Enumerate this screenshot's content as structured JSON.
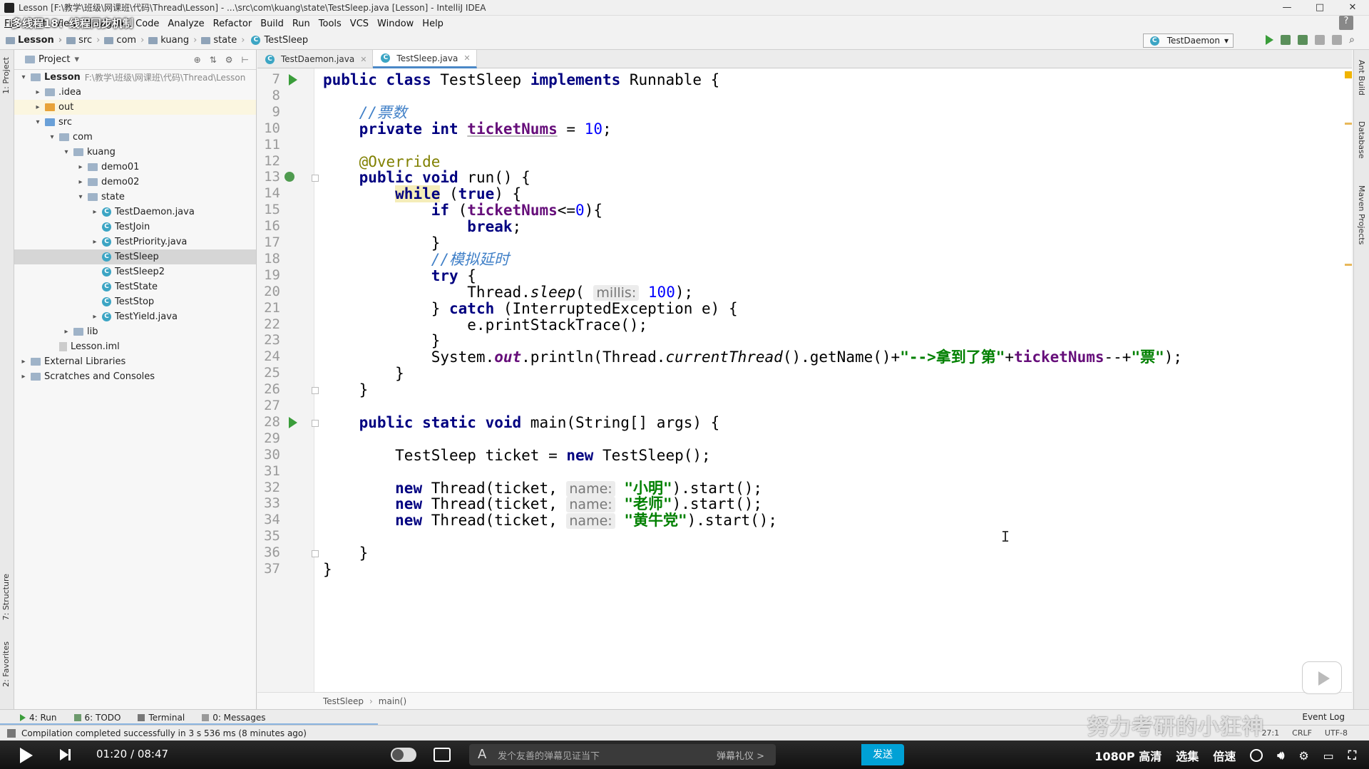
{
  "window": {
    "title": "Lesson [F:\\教学\\班级\\网课班\\代码\\Thread\\Lesson] - ...\\src\\com\\kuang\\state\\TestSleep.java [Lesson] - IntelliJ IDEA",
    "controls": [
      "—",
      "□",
      "✕"
    ]
  },
  "video_title": "多线程18：线程同步机制",
  "menu": [
    "File",
    "Edit",
    "View",
    "Navigate",
    "Code",
    "Analyze",
    "Refactor",
    "Build",
    "Run",
    "Tools",
    "VCS",
    "Window",
    "Help"
  ],
  "breadcrumb": [
    "Lesson",
    "src",
    "com",
    "kuang",
    "state",
    "TestSleep"
  ],
  "run_config": "TestDaemon",
  "project_panel": {
    "title": "Project",
    "tree": [
      {
        "label": "Lesson",
        "path": "F:\\教学\\班级\\网课班\\代码\\Thread\\Lesson",
        "depth": 0,
        "arrow": "▾",
        "icon": "folder",
        "bold": true
      },
      {
        "label": ".idea",
        "depth": 1,
        "arrow": "▸",
        "icon": "folder"
      },
      {
        "label": "out",
        "depth": 1,
        "arrow": "▸",
        "icon": "folder-orange",
        "highlight": true
      },
      {
        "label": "src",
        "depth": 1,
        "arrow": "▾",
        "icon": "folder-blue"
      },
      {
        "label": "com",
        "depth": 2,
        "arrow": "▾",
        "icon": "folder"
      },
      {
        "label": "kuang",
        "depth": 3,
        "arrow": "▾",
        "icon": "folder"
      },
      {
        "label": "demo01",
        "depth": 4,
        "arrow": "▸",
        "icon": "folder"
      },
      {
        "label": "demo02",
        "depth": 4,
        "arrow": "▸",
        "icon": "folder"
      },
      {
        "label": "state",
        "depth": 4,
        "arrow": "▾",
        "icon": "folder"
      },
      {
        "label": "TestDaemon.java",
        "depth": 5,
        "arrow": "▸",
        "icon": "class"
      },
      {
        "label": "TestJoin",
        "depth": 5,
        "arrow": "",
        "icon": "class"
      },
      {
        "label": "TestPriority.java",
        "depth": 5,
        "arrow": "▸",
        "icon": "class"
      },
      {
        "label": "TestSleep",
        "depth": 5,
        "arrow": "",
        "icon": "class",
        "selected": true
      },
      {
        "label": "TestSleep2",
        "depth": 5,
        "arrow": "",
        "icon": "class"
      },
      {
        "label": "TestState",
        "depth": 5,
        "arrow": "",
        "icon": "class"
      },
      {
        "label": "TestStop",
        "depth": 5,
        "arrow": "",
        "icon": "class"
      },
      {
        "label": "TestYield.java",
        "depth": 5,
        "arrow": "▸",
        "icon": "class"
      },
      {
        "label": "lib",
        "depth": 3,
        "arrow": "▸",
        "icon": "folder"
      },
      {
        "label": "Lesson.iml",
        "depth": 2,
        "arrow": "",
        "icon": "file"
      },
      {
        "label": "External Libraries",
        "depth": 0,
        "arrow": "▸",
        "icon": "folder"
      },
      {
        "label": "Scratches and Consoles",
        "depth": 0,
        "arrow": "▸",
        "icon": "folder"
      }
    ]
  },
  "tabs": [
    {
      "label": "TestDaemon.java",
      "active": false
    },
    {
      "label": "TestSleep.java",
      "active": true
    }
  ],
  "editor": {
    "first_line": 7,
    "line_count": 31,
    "lines": [
      [
        {
          "t": "public class ",
          "c": "kw"
        },
        {
          "t": "TestSleep "
        },
        {
          "t": "implements ",
          "c": "kw"
        },
        {
          "t": "Runnable {"
        }
      ],
      [],
      [
        {
          "t": "    "
        },
        {
          "t": "//票数",
          "c": "cm"
        }
      ],
      [
        {
          "t": "    "
        },
        {
          "t": "private int ",
          "c": "kw"
        },
        {
          "t": "ticketNums",
          "c": "fldu"
        },
        {
          "t": " = "
        },
        {
          "t": "10",
          "c": "num"
        },
        {
          "t": ";"
        }
      ],
      [],
      [
        {
          "t": "    "
        },
        {
          "t": "@Override",
          "c": "ann"
        }
      ],
      [
        {
          "t": "    "
        },
        {
          "t": "public void ",
          "c": "kw"
        },
        {
          "t": "run() {"
        }
      ],
      [
        {
          "t": "        "
        },
        {
          "t": "while",
          "c": "kwh"
        },
        {
          "t": " ("
        },
        {
          "t": "true",
          "c": "kw"
        },
        {
          "t": ") {"
        }
      ],
      [
        {
          "t": "            "
        },
        {
          "t": "if ",
          "c": "kw"
        },
        {
          "t": "("
        },
        {
          "t": "ticketNums",
          "c": "fld"
        },
        {
          "t": "<="
        },
        {
          "t": "0",
          "c": "num"
        },
        {
          "t": "){"
        }
      ],
      [
        {
          "t": "                "
        },
        {
          "t": "break",
          "c": "kw"
        },
        {
          "t": ";"
        }
      ],
      [
        {
          "t": "            }"
        }
      ],
      [
        {
          "t": "            "
        },
        {
          "t": "//模拟延时",
          "c": "cm"
        }
      ],
      [
        {
          "t": "            "
        },
        {
          "t": "try ",
          "c": "kw"
        },
        {
          "t": "{"
        }
      ],
      [
        {
          "t": "                Thread."
        },
        {
          "t": "sleep",
          "c": "it"
        },
        {
          "t": "( "
        },
        {
          "t": "millis:",
          "c": "hint"
        },
        {
          "t": " "
        },
        {
          "t": "100",
          "c": "num"
        },
        {
          "t": ");"
        }
      ],
      [
        {
          "t": "            } "
        },
        {
          "t": "catch ",
          "c": "kw"
        },
        {
          "t": "(InterruptedException e) {"
        }
      ],
      [
        {
          "t": "                e.printStackTrace();"
        }
      ],
      [
        {
          "t": "            }"
        }
      ],
      [
        {
          "t": "            System."
        },
        {
          "t": "out",
          "c": "fldi"
        },
        {
          "t": ".println(Thread."
        },
        {
          "t": "currentThread",
          "c": "it"
        },
        {
          "t": "().getName()+"
        },
        {
          "t": "\"-->拿到了第\"",
          "c": "str"
        },
        {
          "t": "+"
        },
        {
          "t": "ticketNums",
          "c": "fld"
        },
        {
          "t": "--+"
        },
        {
          "t": "\"票\"",
          "c": "str"
        },
        {
          "t": ");"
        }
      ],
      [
        {
          "t": "        }"
        }
      ],
      [
        {
          "t": "    }"
        }
      ],
      [],
      [
        {
          "t": "    "
        },
        {
          "t": "public static void ",
          "c": "kw"
        },
        {
          "t": "main(String[] args) {"
        }
      ],
      [],
      [
        {
          "t": "        TestSleep ticket = "
        },
        {
          "t": "new ",
          "c": "kw"
        },
        {
          "t": "TestSleep();"
        }
      ],
      [],
      [
        {
          "t": "        "
        },
        {
          "t": "new ",
          "c": "kw"
        },
        {
          "t": "Thread(ticket, "
        },
        {
          "t": "name:",
          "c": "hint"
        },
        {
          "t": " "
        },
        {
          "t": "\"小明\"",
          "c": "str"
        },
        {
          "t": ").start();"
        }
      ],
      [
        {
          "t": "        "
        },
        {
          "t": "new ",
          "c": "kw"
        },
        {
          "t": "Thread(ticket, "
        },
        {
          "t": "name:",
          "c": "hint"
        },
        {
          "t": " "
        },
        {
          "t": "\"老师\"",
          "c": "str"
        },
        {
          "t": ").start();"
        }
      ],
      [
        {
          "t": "        "
        },
        {
          "t": "new ",
          "c": "kw"
        },
        {
          "t": "Thread(ticket, "
        },
        {
          "t": "name:",
          "c": "hint"
        },
        {
          "t": " "
        },
        {
          "t": "\"黄牛党\"",
          "c": "str"
        },
        {
          "t": ").start();"
        }
      ],
      [],
      [
        {
          "t": "    }"
        }
      ],
      [
        {
          "t": "}"
        }
      ]
    ]
  },
  "editor_breadcrumb": [
    "TestSleep",
    "main()"
  ],
  "side_tabs_left": [
    "1: Project",
    "7: Structure",
    "2: Favorites"
  ],
  "side_tabs_right": [
    "Ant Build",
    "Database",
    "Maven Projects"
  ],
  "bottom_tools": [
    {
      "label": "4: Run"
    },
    {
      "label": "6: TODO"
    },
    {
      "label": "Terminal"
    },
    {
      "label": "0: Messages"
    }
  ],
  "event_log": "Event Log",
  "status": {
    "message": "Compilation completed successfully in 3 s 536 ms (8 minutes ago)",
    "position": "27:1",
    "line_sep": "CRLF",
    "encoding": "UTF-8"
  },
  "player": {
    "time": "01:20 / 08:47",
    "danmaku_placeholder": "发个友善的弹幕见证当下",
    "etiquette": "弹幕礼仪 >",
    "send": "发送",
    "quality": "1080P 高清",
    "episodes": "选集",
    "speed": "倍速"
  },
  "watermark": "努力考研的小狂神"
}
